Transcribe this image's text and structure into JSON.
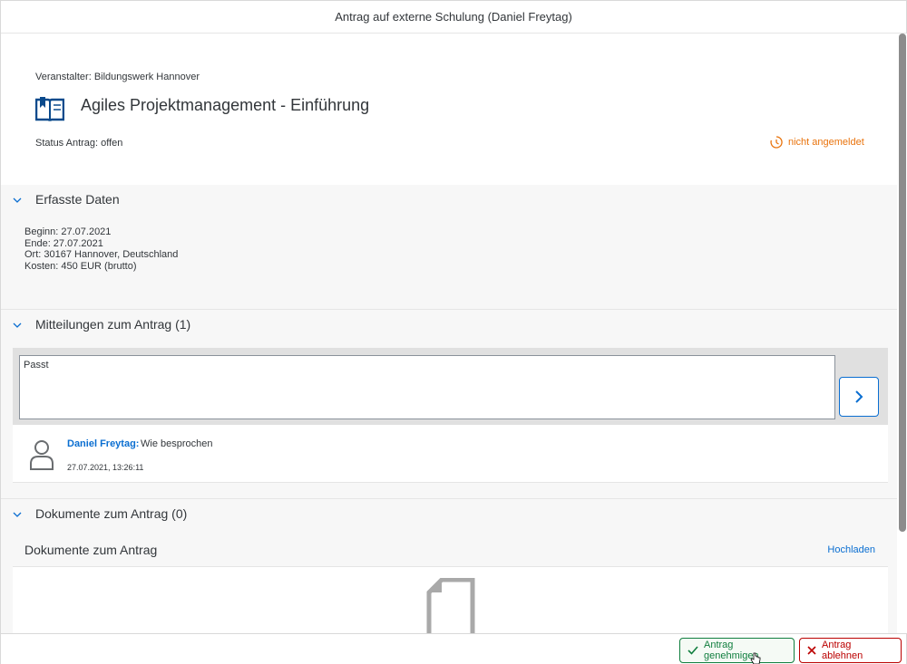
{
  "dialog": {
    "title": "Antrag auf externe Schulung (Daniel Freytag)"
  },
  "header": {
    "organizer": "Veranstalter: Bildungswerk Hannover",
    "course_title": "Agiles Projektmanagement - Einführung",
    "status": "Status Antrag: offen",
    "registration_status": "nicht angemeldet",
    "icon": "book-icon"
  },
  "sections": {
    "data": {
      "title": "Erfasste Daten",
      "facts": [
        "Beginn: 27.07.2021",
        "Ende: 27.07.2021",
        "Ort: 30167 Hannover, Deutschland",
        "Kosten: 450 EUR (brutto)"
      ]
    },
    "messages": {
      "title": "Mitteilungen zum Antrag (1)",
      "input_value": "Passt",
      "feed": {
        "author": "Daniel Freytag:",
        "text": "Wie besprochen",
        "timestamp": "27.07.2021, 13:26:11"
      }
    },
    "documents": {
      "title": "Dokumente zum Antrag (0)",
      "toolbar_title": "Dokumente zum Antrag",
      "upload_label": "Hochladen"
    }
  },
  "footer": {
    "approve_label": "Antrag genehmigen",
    "reject_label": "Antrag ablehnen"
  },
  "colors": {
    "accent": "#0a6ed1",
    "warning": "#e9730c",
    "positive": "#107e3e",
    "negative": "#bb0000"
  }
}
